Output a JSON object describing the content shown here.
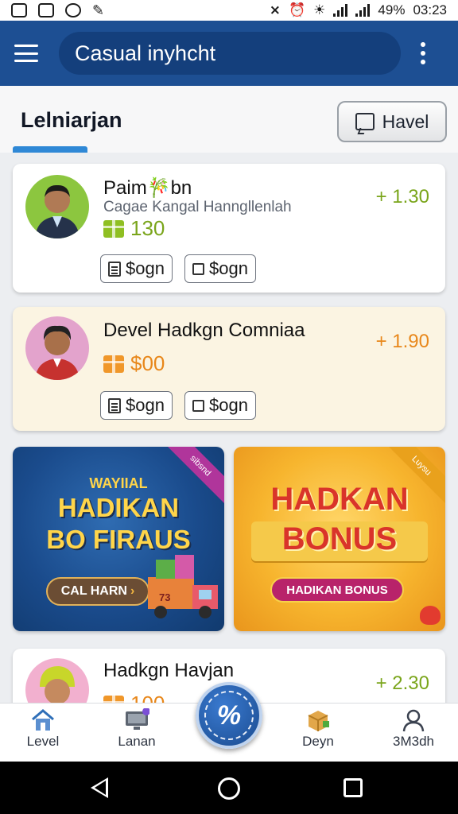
{
  "status_bar": {
    "battery": "49%",
    "time": "03:23"
  },
  "app_bar": {
    "search_text": "Casual inyhcht"
  },
  "tab_header": {
    "title": "Lelniarjan",
    "action_label": "Havel"
  },
  "cards": [
    {
      "name": "Paim🎋bn",
      "subtitle": "Cagae Kangal Hanngllenlah",
      "amount": "130",
      "delta": "+ 1.30",
      "chips": [
        "$ogn",
        "$ogn"
      ],
      "amount_color": "#7aa51b",
      "gift_color": "#8fbf22"
    },
    {
      "name": "Devel Hadkgn Comniaa",
      "amount": "$00",
      "delta": "+ 1.90",
      "chips": [
        "$ogn",
        "$ogn"
      ],
      "amount_color": "#e8871a",
      "gift_color": "#f0972a"
    },
    {
      "name": "Hadkgn Havjan",
      "amount": "100",
      "delta": "+ 2.30",
      "amount_color": "#e8871a",
      "gift_color": "#f0972a"
    }
  ],
  "banners": {
    "left": {
      "kicker": "WAYIIAL",
      "line1": "HADIKAN",
      "line2": "BO FIRAUS",
      "button": "CAL HARN",
      "ribbon": "sibsnd",
      "badge": "73"
    },
    "right": {
      "line1": "HADKAN",
      "line2": "BONUS",
      "button": "HADIKAN BONUS",
      "ribbon": "Luysu"
    }
  },
  "bottom_nav": {
    "items": [
      {
        "label": "Level",
        "icon": "home-icon"
      },
      {
        "label": "Lanan",
        "icon": "monitor-icon",
        "badge": "A"
      },
      {
        "label": "Deyn",
        "icon": "package-icon"
      },
      {
        "label": "3M3dh",
        "icon": "person-icon"
      }
    ],
    "fab_glyph": "%"
  },
  "colors": {
    "app_bar": "#1d4f93",
    "accent": "#2f88d6",
    "positive": "#7aa51b",
    "warm": "#e8871a"
  }
}
